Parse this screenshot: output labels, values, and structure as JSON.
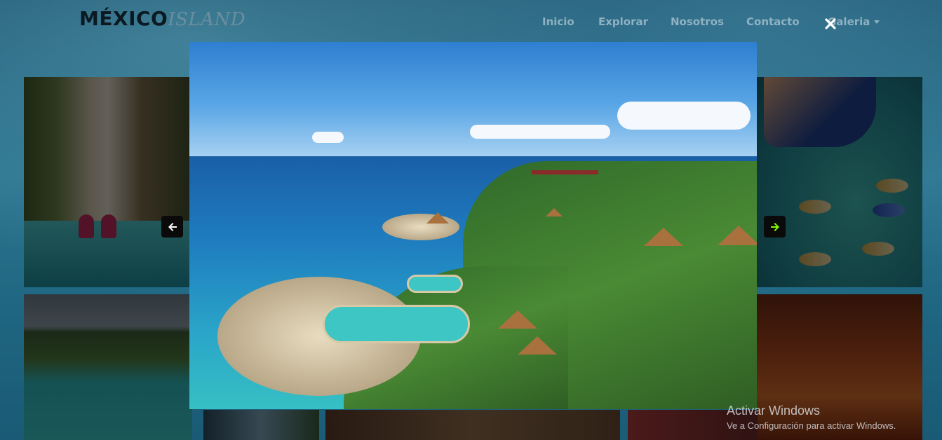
{
  "brand": {
    "main": "MÉXICO",
    "sub": "ISLAND"
  },
  "nav": {
    "items": [
      {
        "label": "Inicio"
      },
      {
        "label": "Explorar"
      },
      {
        "label": "Nosotros"
      },
      {
        "label": "Contacto"
      },
      {
        "label": "Galeria"
      }
    ]
  },
  "lightbox": {
    "close_icon": "close-icon",
    "prev_icon": "arrow-left-icon",
    "next_icon": "arrow-right-icon",
    "next_arrow_color": "#7fff00"
  },
  "watermark": {
    "title": "Activar Windows",
    "subtitle": "Ve a Configuración para activar Windows."
  }
}
